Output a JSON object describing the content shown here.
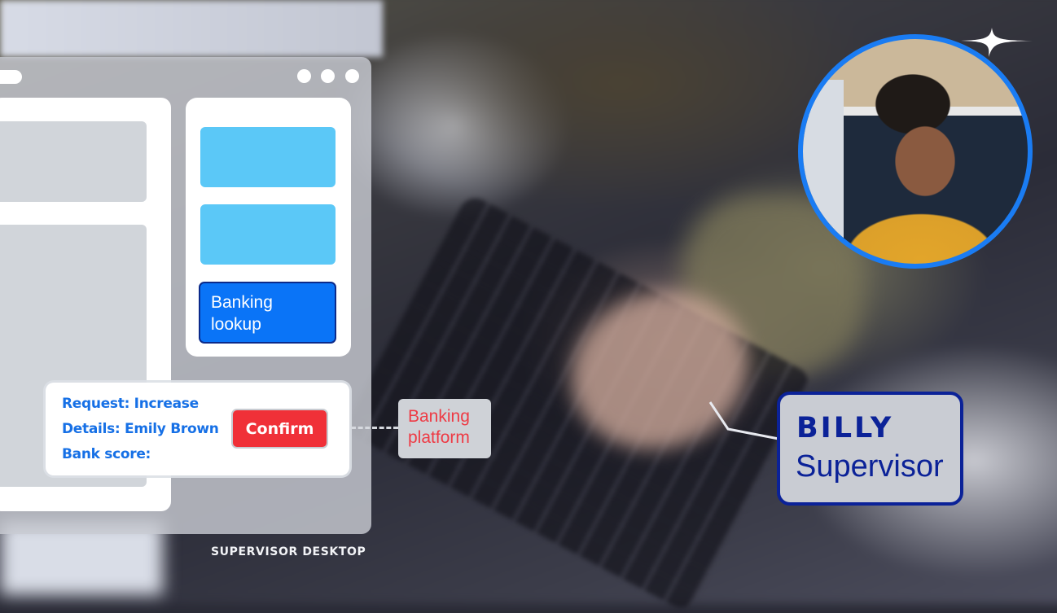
{
  "desktop": {
    "caption": "SUPERVISOR DESKTOP",
    "panel_buttons": [
      {
        "label": ""
      },
      {
        "label": ""
      },
      {
        "label": "Banking lookup"
      }
    ],
    "request_card": {
      "lines": [
        "Request: Increase",
        "Details: Emily Brown",
        "Bank score:"
      ],
      "confirm_label": "Confirm"
    },
    "platform_tag": "Banking platform"
  },
  "agent": {
    "name": "BILLY",
    "role": "Supervisor"
  },
  "colors": {
    "accent_blue": "#0a74f7",
    "cyan": "#5bc8f7",
    "confirm_red": "#f03038",
    "navy": "#0b2298",
    "avatar_ring": "#1a7cf3"
  },
  "icons": {
    "sparkle": "sparkle-icon"
  }
}
